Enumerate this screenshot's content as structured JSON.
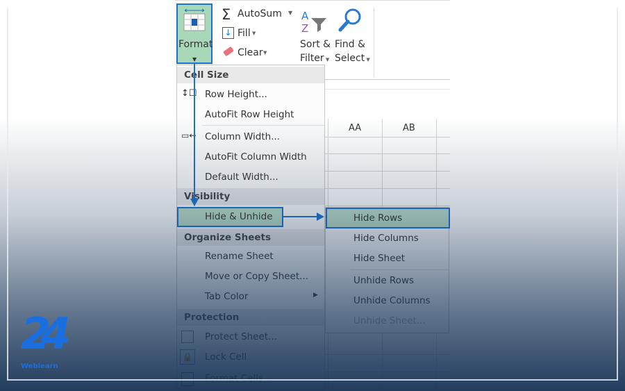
{
  "ribbon": {
    "format": "Format",
    "autosum": "AutoSum",
    "fill": "Fill",
    "clear": "Clear",
    "sort_filter": [
      "Sort &",
      "Filter"
    ],
    "find_select": [
      "Find &",
      "Select"
    ]
  },
  "grid": {
    "columns": [
      "AA",
      "AB"
    ]
  },
  "format_menu": {
    "headers": [
      "Cell Size",
      "Visibility",
      "Organize Sheets",
      "Protection"
    ],
    "items": [
      "Row Height...",
      "AutoFit Row Height",
      "Column Width...",
      "AutoFit Column Width",
      "Default Width...",
      "Hide & Unhide",
      "Rename Sheet",
      "Move or Copy Sheet...",
      "Tab Color",
      "Protect Sheet...",
      "Lock Cell",
      "Format Cells..."
    ]
  },
  "submenu": {
    "items": [
      "Hide Rows",
      "Hide Columns",
      "Hide Sheet",
      "Unhide Rows",
      "Unhide Columns",
      "Unhide Sheet..."
    ]
  },
  "logo": {
    "text": "24",
    "sub": "Weblearn"
  },
  "colors": {
    "highlight_border": "#1a73d1",
    "highlight_fill": "#b9dcc6",
    "overlay": "#1e3a5c",
    "logo": "#1a6fe0"
  }
}
